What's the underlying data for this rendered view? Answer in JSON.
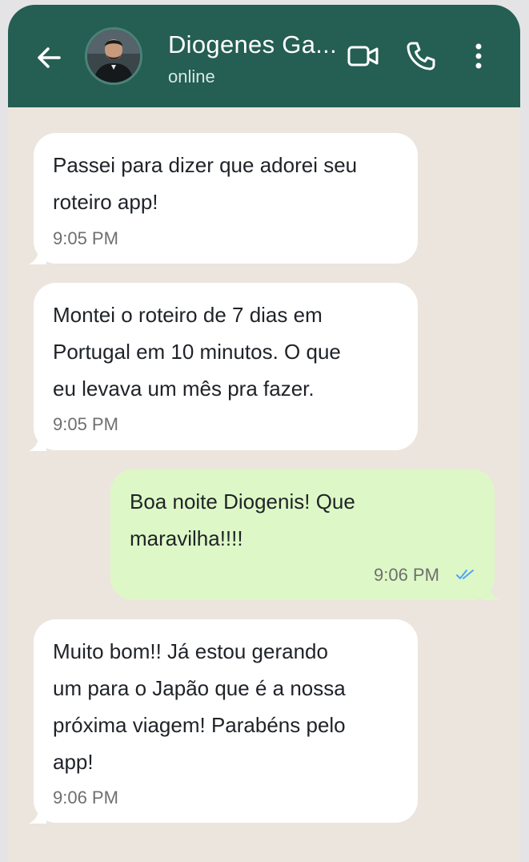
{
  "header": {
    "contact_name": "Diogenes Ga...",
    "status": "online",
    "back_icon": "arrow-left-icon",
    "video_icon": "video-call-icon",
    "call_icon": "phone-call-icon",
    "menu_icon": "more-vertical-icon"
  },
  "colors": {
    "header_bg": "#255e53",
    "chat_bg": "#ece5dd",
    "incoming_bubble": "#ffffff",
    "outgoing_bubble": "#ddf8c6",
    "read_ticks": "#4fa3f7"
  },
  "messages": [
    {
      "direction": "in",
      "text": "Passei para dizer que adorei seu\nroteiro app!",
      "time": "9:05 PM"
    },
    {
      "direction": "in",
      "text": "Montei o roteiro de 7 dias em\nPortugal em 10 minutos. O que\neu levava um mês pra fazer.",
      "time": "9:05 PM"
    },
    {
      "direction": "out",
      "text": "Boa noite Diogenis! Que\nmaravilha!!!!",
      "time": "9:06 PM",
      "status_icon": "double-check-read-icon"
    },
    {
      "direction": "in",
      "text": "Muito bom!! Já estou gerando\num para o Japão que é a nossa\npróxima viagem! Parabéns pelo\napp!",
      "time": "9:06 PM"
    }
  ]
}
